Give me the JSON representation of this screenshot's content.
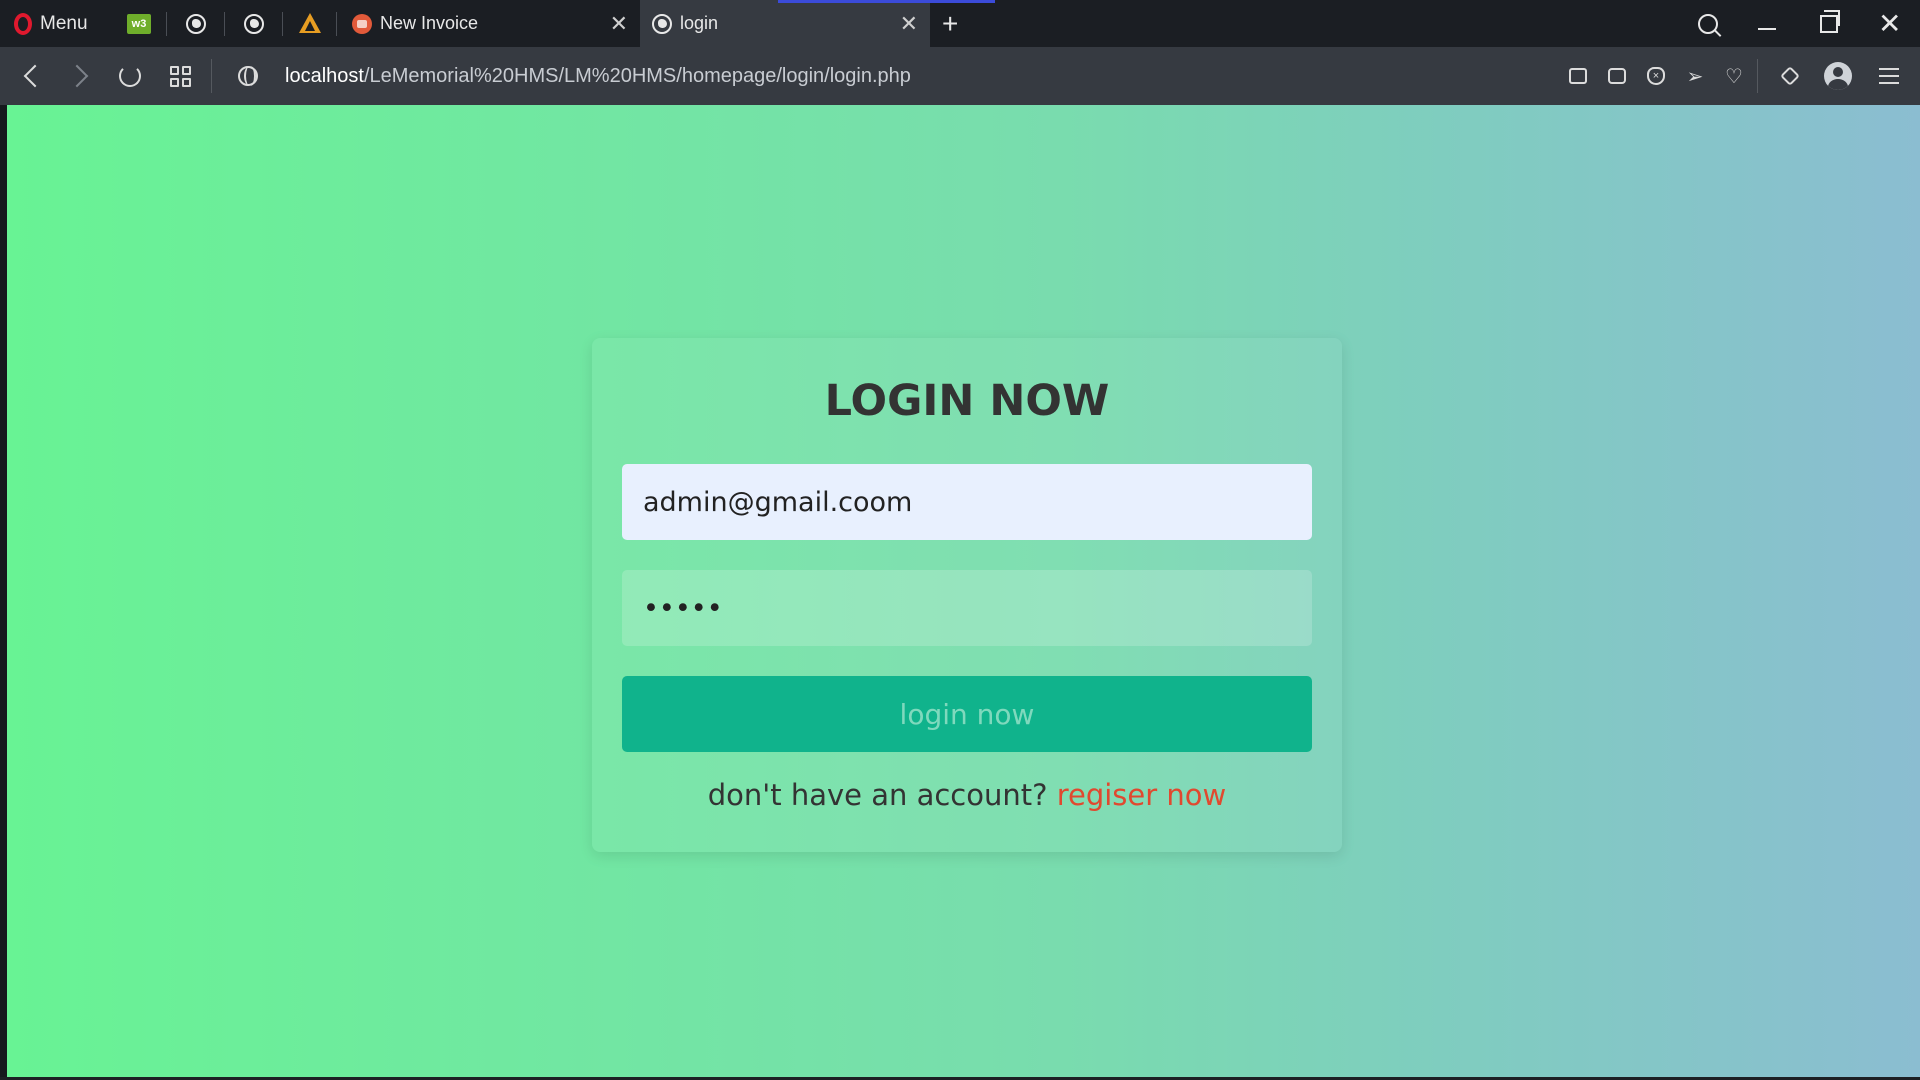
{
  "browser": {
    "menu_label": "Menu",
    "pinned_tabs": [
      {
        "icon": "w3schools-icon",
        "text": "w3"
      },
      {
        "icon": "globe-icon"
      },
      {
        "icon": "globe-icon"
      },
      {
        "icon": "phpmyadmin-icon"
      }
    ],
    "tabs": [
      {
        "title": "New Invoice",
        "icon": "invoice-icon",
        "active": false
      },
      {
        "title": "login",
        "icon": "globe-icon",
        "active": true
      }
    ],
    "new_tab_glyph": "+",
    "window_close_glyph": "✕",
    "tab_close_glyph": "✕",
    "url_host": "localhost",
    "url_path": "/LeMemorial%20HMS/LM%20HMS/homepage/login/login.php",
    "toolbar_icons": [
      "easy-setup-icon",
      "snapshot-icon",
      "adblock-shield-icon",
      "send-icon",
      "heart-icon",
      "extensions-cube-icon",
      "profile-avatar-icon",
      "easy-setup-sliders-icon"
    ],
    "colors": {
      "active_tab_indicator": "#3b4bd9",
      "opera_red": "#e0192e"
    }
  },
  "login": {
    "title": "LOGIN NOW",
    "email_value": "admin@gmail.coom",
    "password_value": "abcde",
    "button_label": "login now",
    "register_prompt": "don't have an account?",
    "register_link": "regiser now",
    "colors": {
      "button_bg": "#10b38c",
      "link": "#e0492f",
      "gradient_start": "#68f394",
      "gradient_end": "#8bbdd1"
    }
  }
}
